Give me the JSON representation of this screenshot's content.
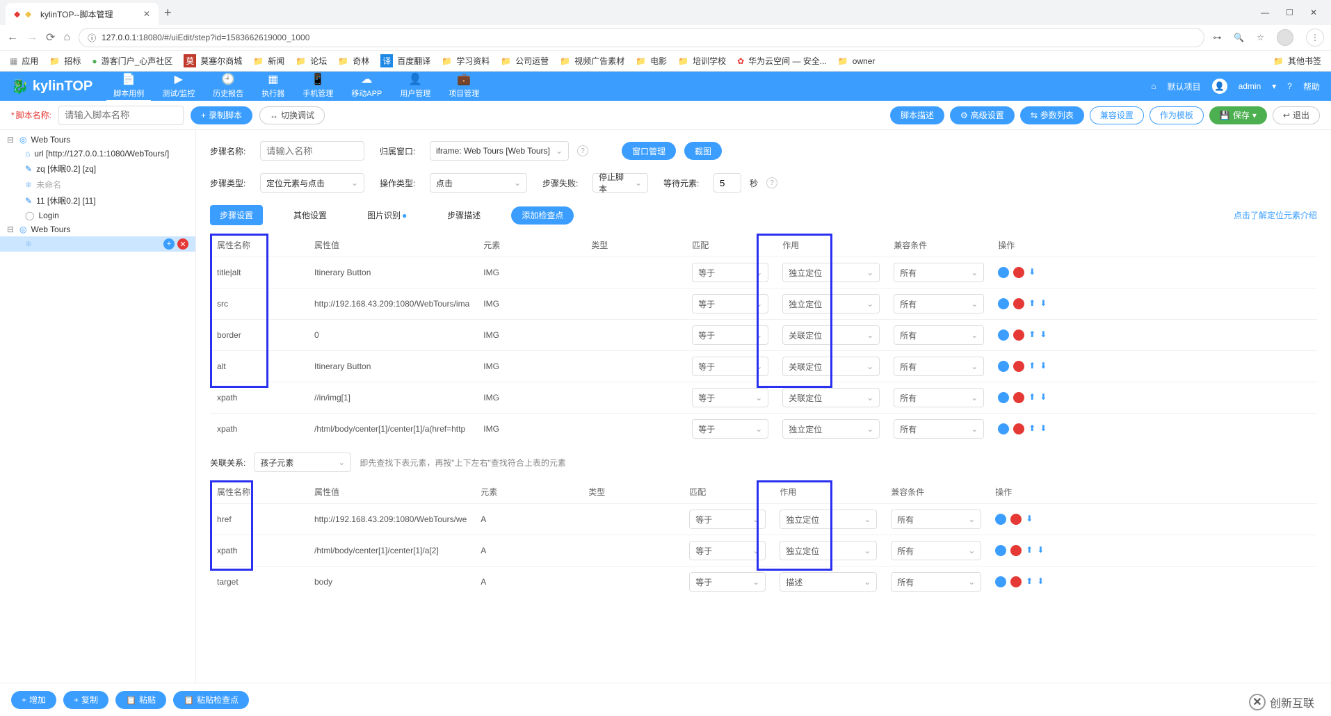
{
  "browser": {
    "tab_title": "kylinTOP--脚本管理",
    "url_host": "127.0.0.1",
    "url_port": ":18080",
    "url_path": "/#/uiEdit/step?id=1583662619000_1000",
    "apps_label": "应用",
    "bookmarks": [
      "招标",
      "游客门户_心声社区",
      "莫塞尔商城",
      "新闻",
      "论坛",
      "奇林",
      "百度翻译",
      "学习资料",
      "公司运营",
      "视频广告素材",
      "电影",
      "培训学校",
      "华为云空间 — 安全...",
      "owner"
    ],
    "other_bm": "其他书签"
  },
  "app_top": {
    "logo": "kylinTOP",
    "nav": [
      "脚本用例",
      "测试/监控",
      "历史报告",
      "执行器",
      "手机管理",
      "移动APP",
      "用户管理",
      "项目管理"
    ],
    "project": "默认项目",
    "user": "admin",
    "help": "帮助"
  },
  "toolbar": {
    "script_name_lbl": "脚本名称:",
    "script_name_ph": "请输入脚本名称",
    "record_btn": "录制脚本",
    "switch_btn": "切换调试",
    "right_btns": [
      "脚本描述",
      "高级设置",
      "参数列表",
      "兼容设置",
      "作为模板",
      "保存",
      "退出"
    ]
  },
  "tree": {
    "root1": "Web Tours",
    "items1": [
      "url [http://127.0.0.1:1080/WebTours/]",
      "zq [休眠0.2] [zq]",
      "未命名",
      "11 [休眠0.2] [11]",
      "Login"
    ],
    "root2": "Web Tours",
    "selected": ""
  },
  "form": {
    "step_name_lbl": "步骤名称:",
    "step_name_ph": "请输入名称",
    "belong_window_lbl": "归属窗口:",
    "belong_window_val": "iframe: Web Tours [Web Tours]",
    "window_mgmt": "窗口管理",
    "screenshot": "截图",
    "step_type_lbl": "步骤类型:",
    "step_type_val": "定位元素与点击",
    "op_type_lbl": "操作类型:",
    "op_type_val": "点击",
    "step_fail_lbl": "步骤失败:",
    "step_fail_val": "停止脚本",
    "wait_lbl": "等待元素:",
    "wait_val": "5",
    "wait_unit": "秒"
  },
  "tabs": {
    "items": [
      "步骤设置",
      "其他设置",
      "图片识别",
      "步骤描述"
    ],
    "add_check": "添加检查点",
    "link_right": "点击了解定位元素介绍"
  },
  "table1": {
    "headers": [
      "属性名称",
      "属性值",
      "元素",
      "类型",
      "匹配",
      "作用",
      "兼容条件",
      "操作"
    ],
    "rows": [
      {
        "attr": "title|alt",
        "val": "Itinerary Button",
        "elem": "IMG",
        "match": "等于",
        "role": "独立定位",
        "compat": "所有"
      },
      {
        "attr": "src",
        "val": "http://192.168.43.209:1080/WebTours/ima",
        "elem": "IMG",
        "match": "等于",
        "role": "独立定位",
        "compat": "所有"
      },
      {
        "attr": "border",
        "val": "0",
        "elem": "IMG",
        "match": "等于",
        "role": "关联定位",
        "compat": "所有"
      },
      {
        "attr": "alt",
        "val": "Itinerary Button",
        "elem": "IMG",
        "match": "等于",
        "role": "关联定位",
        "compat": "所有"
      },
      {
        "attr": "xpath",
        "val": "//in/img[1]",
        "elem": "IMG",
        "match": "等于",
        "role": "关联定位",
        "compat": "所有"
      },
      {
        "attr": "xpath",
        "val": "/html/body/center[1]/center[1]/a(href=http",
        "elem": "IMG",
        "match": "等于",
        "role": "独立定位",
        "compat": "所有"
      }
    ]
  },
  "relation": {
    "lbl": "关联关系:",
    "val": "孩子元素",
    "hint": "即先查找下表元素，再按\"上下左右\"查找符合上表的元素"
  },
  "table2": {
    "headers": [
      "属性名称",
      "属性值",
      "元素",
      "类型",
      "匹配",
      "作用",
      "兼容条件",
      "操作"
    ],
    "rows": [
      {
        "attr": "href",
        "val": "http://192.168.43.209:1080/WebTours/we",
        "elem": "A",
        "match": "等于",
        "role": "独立定位",
        "compat": "所有"
      },
      {
        "attr": "xpath",
        "val": "/html/body/center[1]/center[1]/a[2]",
        "elem": "A",
        "match": "等于",
        "role": "独立定位",
        "compat": "所有"
      },
      {
        "attr": "target",
        "val": "body",
        "elem": "A",
        "match": "等于",
        "role": "描述",
        "compat": "所有"
      }
    ]
  },
  "footer": {
    "btns": [
      "增加",
      "复制",
      "粘贴",
      "粘贴检查点"
    ]
  },
  "watermark": "创新互联"
}
